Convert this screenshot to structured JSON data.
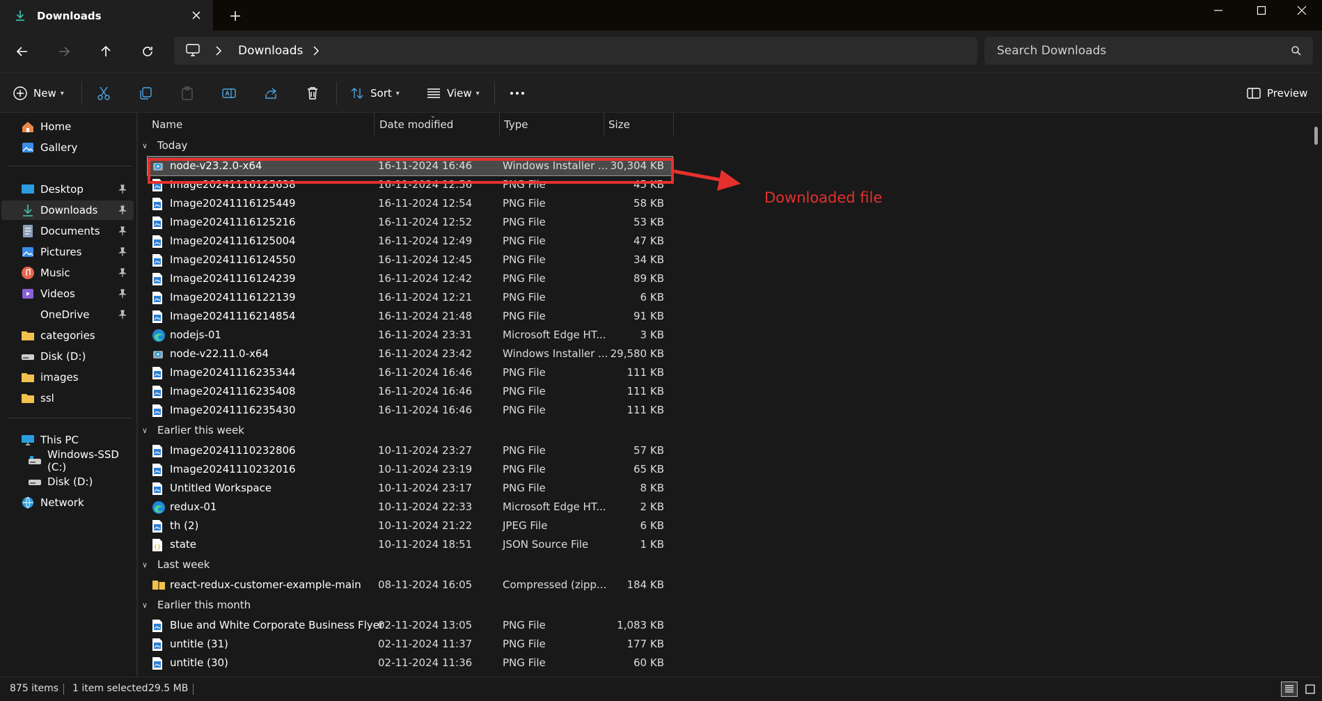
{
  "titlebar": {
    "tab_title": "Downloads",
    "icons": [
      "download-icon",
      "close-icon",
      "plus-icon",
      "minimize-icon",
      "maximize-icon",
      "close-window-icon"
    ]
  },
  "address": {
    "breadcrumb": "Downloads",
    "search_placeholder": "Search Downloads"
  },
  "toolbar": {
    "new_label": "New",
    "sort_label": "Sort",
    "view_label": "View",
    "preview_label": "Preview"
  },
  "nav": {
    "quick": [
      {
        "label": "Home",
        "icon": "home-icon"
      },
      {
        "label": "Gallery",
        "icon": "gallery-icon"
      }
    ],
    "pinned": [
      {
        "label": "Desktop",
        "icon": "desktop-icon",
        "pinned": true
      },
      {
        "label": "Downloads",
        "icon": "download-icon",
        "pinned": true,
        "selected": true
      },
      {
        "label": "Documents",
        "icon": "documents-icon",
        "pinned": true
      },
      {
        "label": "Pictures",
        "icon": "pictures-icon",
        "pinned": true
      },
      {
        "label": "Music",
        "icon": "music-icon",
        "pinned": true
      },
      {
        "label": "Videos",
        "icon": "videos-icon",
        "pinned": true
      },
      {
        "label": "OneDrive",
        "icon": "onedrive-icon",
        "pinned": true
      },
      {
        "label": "categories",
        "icon": "folder-icon"
      },
      {
        "label": "Disk (D:)",
        "icon": "drive-icon"
      },
      {
        "label": "images",
        "icon": "folder-icon"
      },
      {
        "label": "ssl",
        "icon": "folder-icon"
      }
    ],
    "pc": [
      {
        "label": "This PC",
        "icon": "pc-icon"
      },
      {
        "label": "Windows-SSD (C:)",
        "icon": "drive-icon"
      },
      {
        "label": "Disk (D:)",
        "icon": "drive-icon"
      },
      {
        "label": "Network",
        "icon": "network-icon"
      }
    ]
  },
  "columns": {
    "name": "Name",
    "date": "Date modified",
    "type": "Type",
    "size": "Size"
  },
  "groups": [
    {
      "label": "Today",
      "files": [
        {
          "name": "node-v23.2.0-x64",
          "date": "16-11-2024 16:46",
          "type": "Windows Installer ...",
          "size": "30,304 KB",
          "icon": "installer-icon",
          "selected": true
        },
        {
          "name": "Image20241116125638",
          "date": "16-11-2024 12:56",
          "type": "PNG File",
          "size": "45 KB",
          "icon": "image-file-icon"
        },
        {
          "name": "Image20241116125449",
          "date": "16-11-2024 12:54",
          "type": "PNG File",
          "size": "58 KB",
          "icon": "image-file-icon"
        },
        {
          "name": "Image20241116125216",
          "date": "16-11-2024 12:52",
          "type": "PNG File",
          "size": "53 KB",
          "icon": "image-file-icon"
        },
        {
          "name": "Image20241116125004",
          "date": "16-11-2024 12:49",
          "type": "PNG File",
          "size": "47 KB",
          "icon": "image-file-icon"
        },
        {
          "name": "Image20241116124550",
          "date": "16-11-2024 12:45",
          "type": "PNG File",
          "size": "34 KB",
          "icon": "image-file-icon"
        },
        {
          "name": "Image20241116124239",
          "date": "16-11-2024 12:42",
          "type": "PNG File",
          "size": "89 KB",
          "icon": "image-file-icon"
        },
        {
          "name": "Image20241116122139",
          "date": "16-11-2024 12:21",
          "type": "PNG File",
          "size": "6 KB",
          "icon": "image-file-icon"
        },
        {
          "name": "Image20241116214854",
          "date": "16-11-2024 21:48",
          "type": "PNG File",
          "size": "91 KB",
          "icon": "image-file-icon"
        },
        {
          "name": "nodejs-01",
          "date": "16-11-2024 23:31",
          "type": "Microsoft Edge HT...",
          "size": "3 KB",
          "icon": "edge-icon"
        },
        {
          "name": "node-v22.11.0-x64",
          "date": "16-11-2024 23:42",
          "type": "Windows Installer ...",
          "size": "29,580 KB",
          "icon": "installer-icon"
        },
        {
          "name": "Image20241116235344",
          "date": "16-11-2024 16:46",
          "type": "PNG File",
          "size": "111 KB",
          "icon": "image-file-icon"
        },
        {
          "name": "Image20241116235408",
          "date": "16-11-2024 16:46",
          "type": "PNG File",
          "size": "111 KB",
          "icon": "image-file-icon"
        },
        {
          "name": "Image20241116235430",
          "date": "16-11-2024 16:46",
          "type": "PNG File",
          "size": "111 KB",
          "icon": "image-file-icon"
        }
      ]
    },
    {
      "label": "Earlier this week",
      "files": [
        {
          "name": "Image20241110232806",
          "date": "10-11-2024 23:27",
          "type": "PNG File",
          "size": "57 KB",
          "icon": "image-file-icon"
        },
        {
          "name": "Image20241110232016",
          "date": "10-11-2024 23:19",
          "type": "PNG File",
          "size": "65 KB",
          "icon": "image-file-icon"
        },
        {
          "name": "Untitled Workspace",
          "date": "10-11-2024 23:17",
          "type": "PNG File",
          "size": "8 KB",
          "icon": "image-file-icon"
        },
        {
          "name": "redux-01",
          "date": "10-11-2024 22:33",
          "type": "Microsoft Edge HT...",
          "size": "2 KB",
          "icon": "edge-icon"
        },
        {
          "name": "th (2)",
          "date": "10-11-2024 21:22",
          "type": "JPEG File",
          "size": "6 KB",
          "icon": "image-file-icon"
        },
        {
          "name": "state",
          "date": "10-11-2024 18:51",
          "type": "JSON Source File",
          "size": "1 KB",
          "icon": "json-file-icon"
        }
      ]
    },
    {
      "label": "Last week",
      "files": [
        {
          "name": "react-redux-customer-example-main",
          "date": "08-11-2024 16:05",
          "type": "Compressed (zipp...",
          "size": "184 KB",
          "icon": "zip-folder-icon"
        }
      ]
    },
    {
      "label": "Earlier this month",
      "files": [
        {
          "name": "Blue and White Corporate Business Flyer",
          "date": "02-11-2024 13:05",
          "type": "PNG File",
          "size": "1,083 KB",
          "icon": "image-file-icon"
        },
        {
          "name": "untitle (31)",
          "date": "02-11-2024 11:37",
          "type": "PNG File",
          "size": "177 KB",
          "icon": "image-file-icon"
        },
        {
          "name": "untitle (30)",
          "date": "02-11-2024 11:36",
          "type": "PNG File",
          "size": "60 KB",
          "icon": "image-file-icon"
        }
      ]
    }
  ],
  "annotation": {
    "label": "Downloaded file",
    "color": "#e5302e"
  },
  "status": {
    "items_count": "875 items",
    "selection": "1 item selected",
    "selection_size": "29.5 MB"
  }
}
